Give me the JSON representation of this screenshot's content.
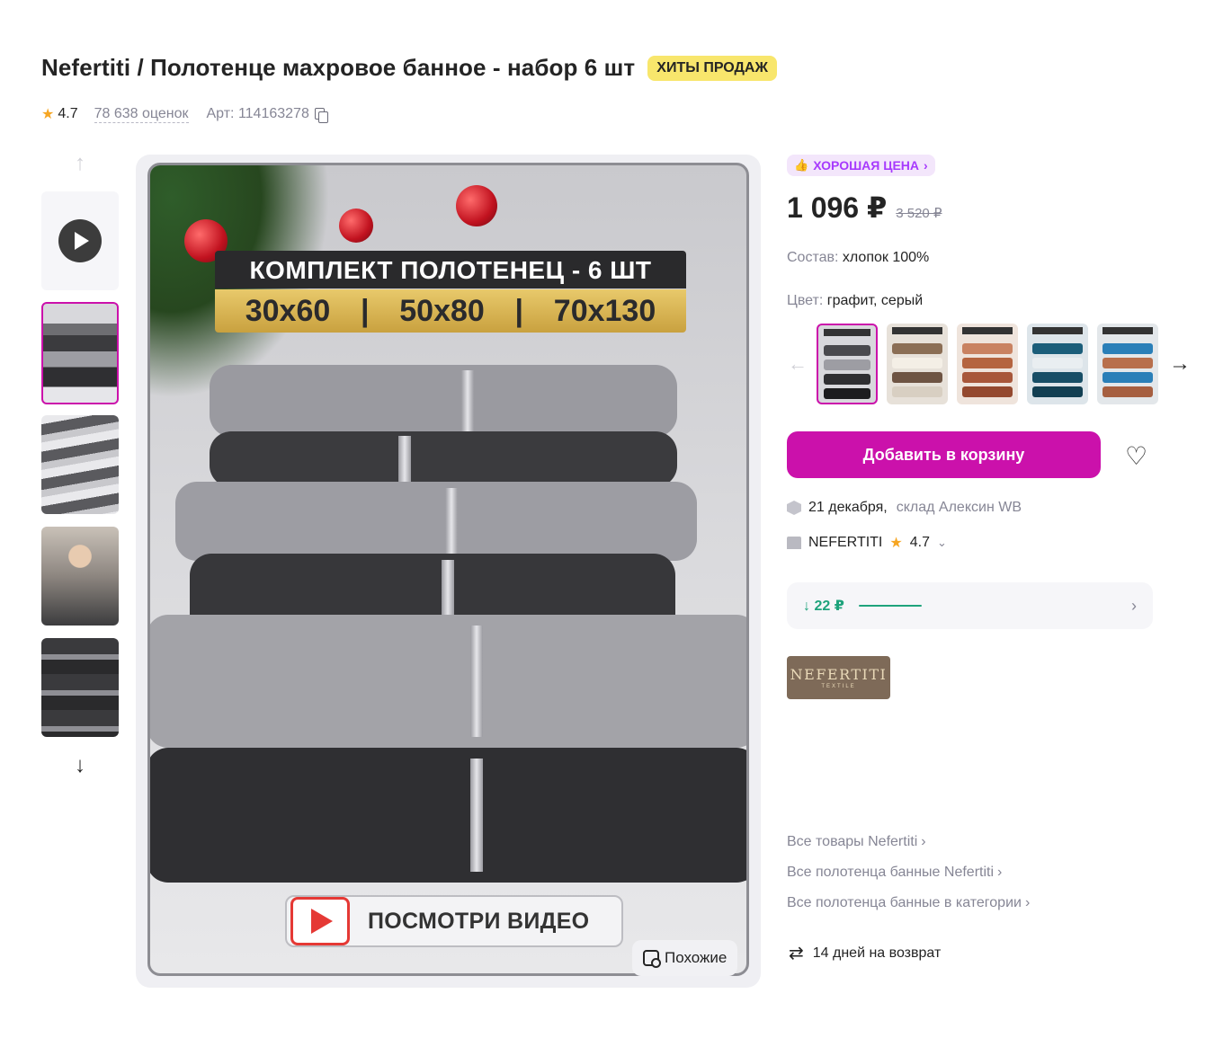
{
  "product": {
    "title": "Nefertiti / Полотенце махровое банное - набор 6 шт",
    "badge": "ХИТЫ ПРОДАЖ",
    "rating": "4.7",
    "reviews": "78 638 оценок",
    "article": "Арт: 114163278"
  },
  "gallery": {
    "banner_title": "КОМПЛЕКТ ПОЛОТЕНЕЦ - 6 ШТ",
    "sizes": [
      "30х60",
      "50х80",
      "70х130"
    ],
    "video_label": "ПОСМОТРИ ВИДЕО",
    "similar_label": "Похожие",
    "icons": [
      "arrow-up-icon",
      "arrow-down-icon",
      "play-icon",
      "similar-search-icon"
    ]
  },
  "pricing": {
    "good_price": "ХОРОШАЯ ЦЕНА",
    "current": "1 096 ₽",
    "old": "3 520 ₽",
    "drop": "↓ 22 ₽"
  },
  "specs": {
    "composition_key": "Состав:",
    "composition_val": "хлопок 100%",
    "color_key": "Цвет:",
    "color_val": "графит, серый"
  },
  "color_variants": [
    {
      "name": "graphite-grey",
      "color": "#4a4a4e"
    },
    {
      "name": "brown-beige",
      "color": "#8b6e55"
    },
    {
      "name": "terracotta",
      "color": "#b5643f"
    },
    {
      "name": "teal-blue",
      "color": "#1b5e7a"
    },
    {
      "name": "blue-brown",
      "color": "#2a7fb8"
    }
  ],
  "actions": {
    "add_to_cart": "Добавить в корзину"
  },
  "delivery": {
    "date": "21 декабря,",
    "warehouse": "склад Алексин WB"
  },
  "seller": {
    "name": "NEFERTITI",
    "rating": "4.7"
  },
  "brand_logo": {
    "name": "NEFERTITI",
    "sub": "TEXTILE"
  },
  "links": [
    "Все товары Nefertiti",
    "Все полотенца банные Nefertiti",
    "Все полотенца банные в категории"
  ],
  "returns": "14 дней на возврат",
  "colors": {
    "accent": "#cb11ab",
    "badge": "#f8e66c",
    "good_price_bg": "#f3e6fb",
    "good_price_text": "#a73afd",
    "price_drop": "#1fa37c",
    "star": "#f6a623"
  }
}
